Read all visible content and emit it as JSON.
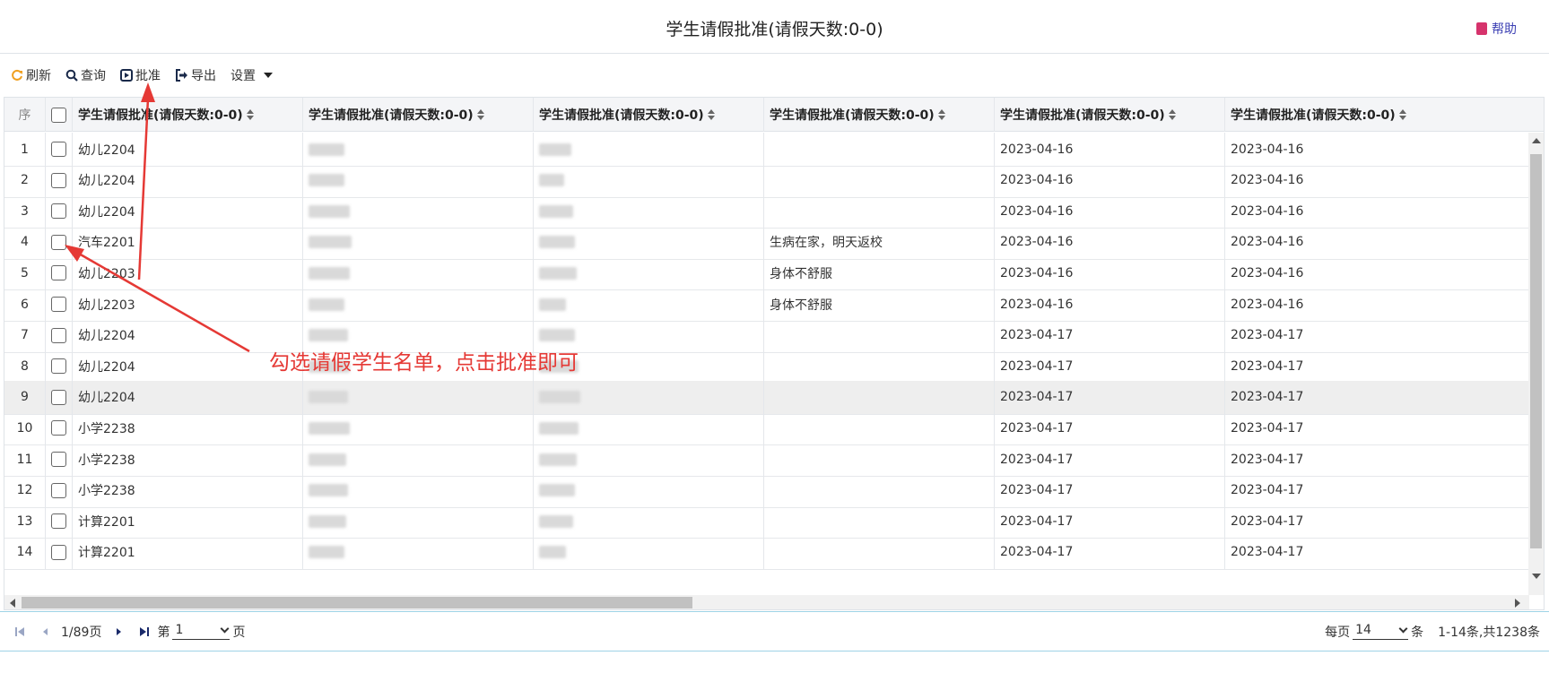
{
  "title": "学生请假批准(请假天数:0-0)",
  "help_label": "帮助",
  "toolbar": {
    "refresh": "刷新",
    "query": "查询",
    "approve": "批准",
    "export": "导出",
    "settings": "设置"
  },
  "grid": {
    "index_header": "序",
    "column_headers": [
      "学生请假批准(请假天数:0-0)",
      "学生请假批准(请假天数:0-0)",
      "学生请假批准(请假天数:0-0)",
      "学生请假批准(请假天数:0-0)",
      "学生请假批准(请假天数:0-0)",
      "学生请假批准(请假天数:0-0)"
    ],
    "rows": [
      {
        "idx": "1",
        "cls": "幼儿2204",
        "reason": "",
        "date1": "2023-04-16",
        "date2": "2023-04-16"
      },
      {
        "idx": "2",
        "cls": "幼儿2204",
        "reason": "",
        "date1": "2023-04-16",
        "date2": "2023-04-16"
      },
      {
        "idx": "3",
        "cls": "幼儿2204",
        "reason": "",
        "date1": "2023-04-16",
        "date2": "2023-04-16"
      },
      {
        "idx": "4",
        "cls": "汽车2201",
        "reason": "生病在家，明天返校",
        "date1": "2023-04-16",
        "date2": "2023-04-16"
      },
      {
        "idx": "5",
        "cls": "幼儿2203",
        "reason": "身体不舒服",
        "date1": "2023-04-16",
        "date2": "2023-04-16"
      },
      {
        "idx": "6",
        "cls": "幼儿2203",
        "reason": "身体不舒服",
        "date1": "2023-04-16",
        "date2": "2023-04-16"
      },
      {
        "idx": "7",
        "cls": "幼儿2204",
        "reason": "",
        "date1": "2023-04-17",
        "date2": "2023-04-17"
      },
      {
        "idx": "8",
        "cls": "幼儿2204",
        "reason": "",
        "date1": "2023-04-17",
        "date2": "2023-04-17"
      },
      {
        "idx": "9",
        "cls": "幼儿2204",
        "reason": "",
        "date1": "2023-04-17",
        "date2": "2023-04-17"
      },
      {
        "idx": "10",
        "cls": "小学2238",
        "reason": "",
        "date1": "2023-04-17",
        "date2": "2023-04-17"
      },
      {
        "idx": "11",
        "cls": "小学2238",
        "reason": "",
        "date1": "2023-04-17",
        "date2": "2023-04-17"
      },
      {
        "idx": "12",
        "cls": "小学2238",
        "reason": "",
        "date1": "2023-04-17",
        "date2": "2023-04-17"
      },
      {
        "idx": "13",
        "cls": "计算2201",
        "reason": "",
        "date1": "2023-04-17",
        "date2": "2023-04-17"
      },
      {
        "idx": "14",
        "cls": "计算2201",
        "reason": "",
        "date1": "2023-04-17",
        "date2": "2023-04-17"
      }
    ],
    "highlighted_row": 9
  },
  "pager": {
    "page_info": "1/89页",
    "goto_prefix": "第",
    "page_value": "1",
    "goto_suffix": "页",
    "per_page_prefix": "每页",
    "per_page_value": "14",
    "per_page_suffix": "条",
    "summary": "1-14条,共1238条"
  },
  "annotation": {
    "text": "勾选请假学生名单，点击批准即可",
    "color": "#e53935"
  },
  "colors": {
    "accent_refresh": "#f0a020",
    "help_book": "#d6336c",
    "pager_border": "#9fd3e6",
    "row_highlight": "#eeeeee"
  }
}
